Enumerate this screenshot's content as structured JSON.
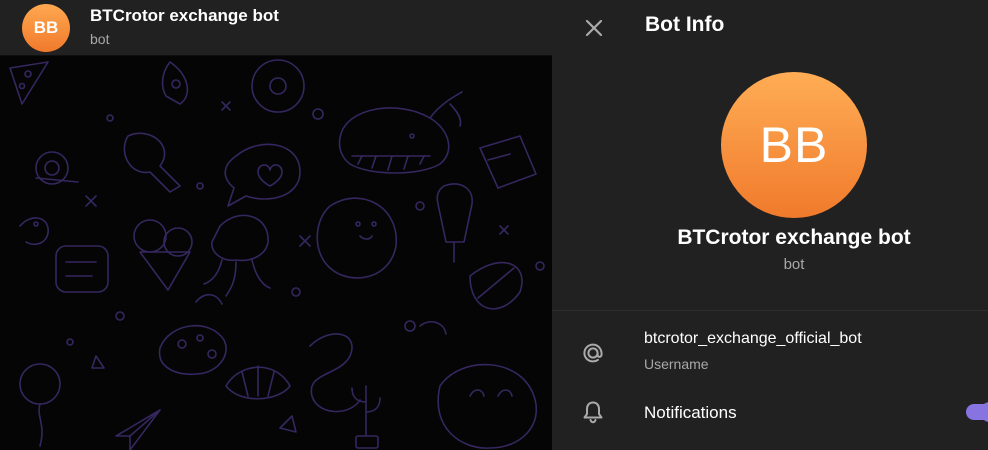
{
  "chat_header": {
    "avatar_initials": "BB",
    "title": "BTCrotor exchange bot",
    "subtitle": "bot"
  },
  "info_panel": {
    "title": "Bot Info",
    "avatar_initials": "BB",
    "name": "BTCrotor exchange bot",
    "status": "bot",
    "username_value": "btcrotor_exchange_official_bot",
    "username_label": "Username",
    "notifications_label": "Notifications",
    "notifications_enabled": true
  },
  "colors": {
    "avatar_top": "#ffad55",
    "avatar_bottom": "#f07a2c",
    "accent": "#8774e1",
    "panel_bg": "#212121",
    "doodle": "#3a2a6a"
  },
  "icons": {
    "close": "close-icon",
    "username": "at-sign-icon",
    "notifications": "bell-icon"
  }
}
